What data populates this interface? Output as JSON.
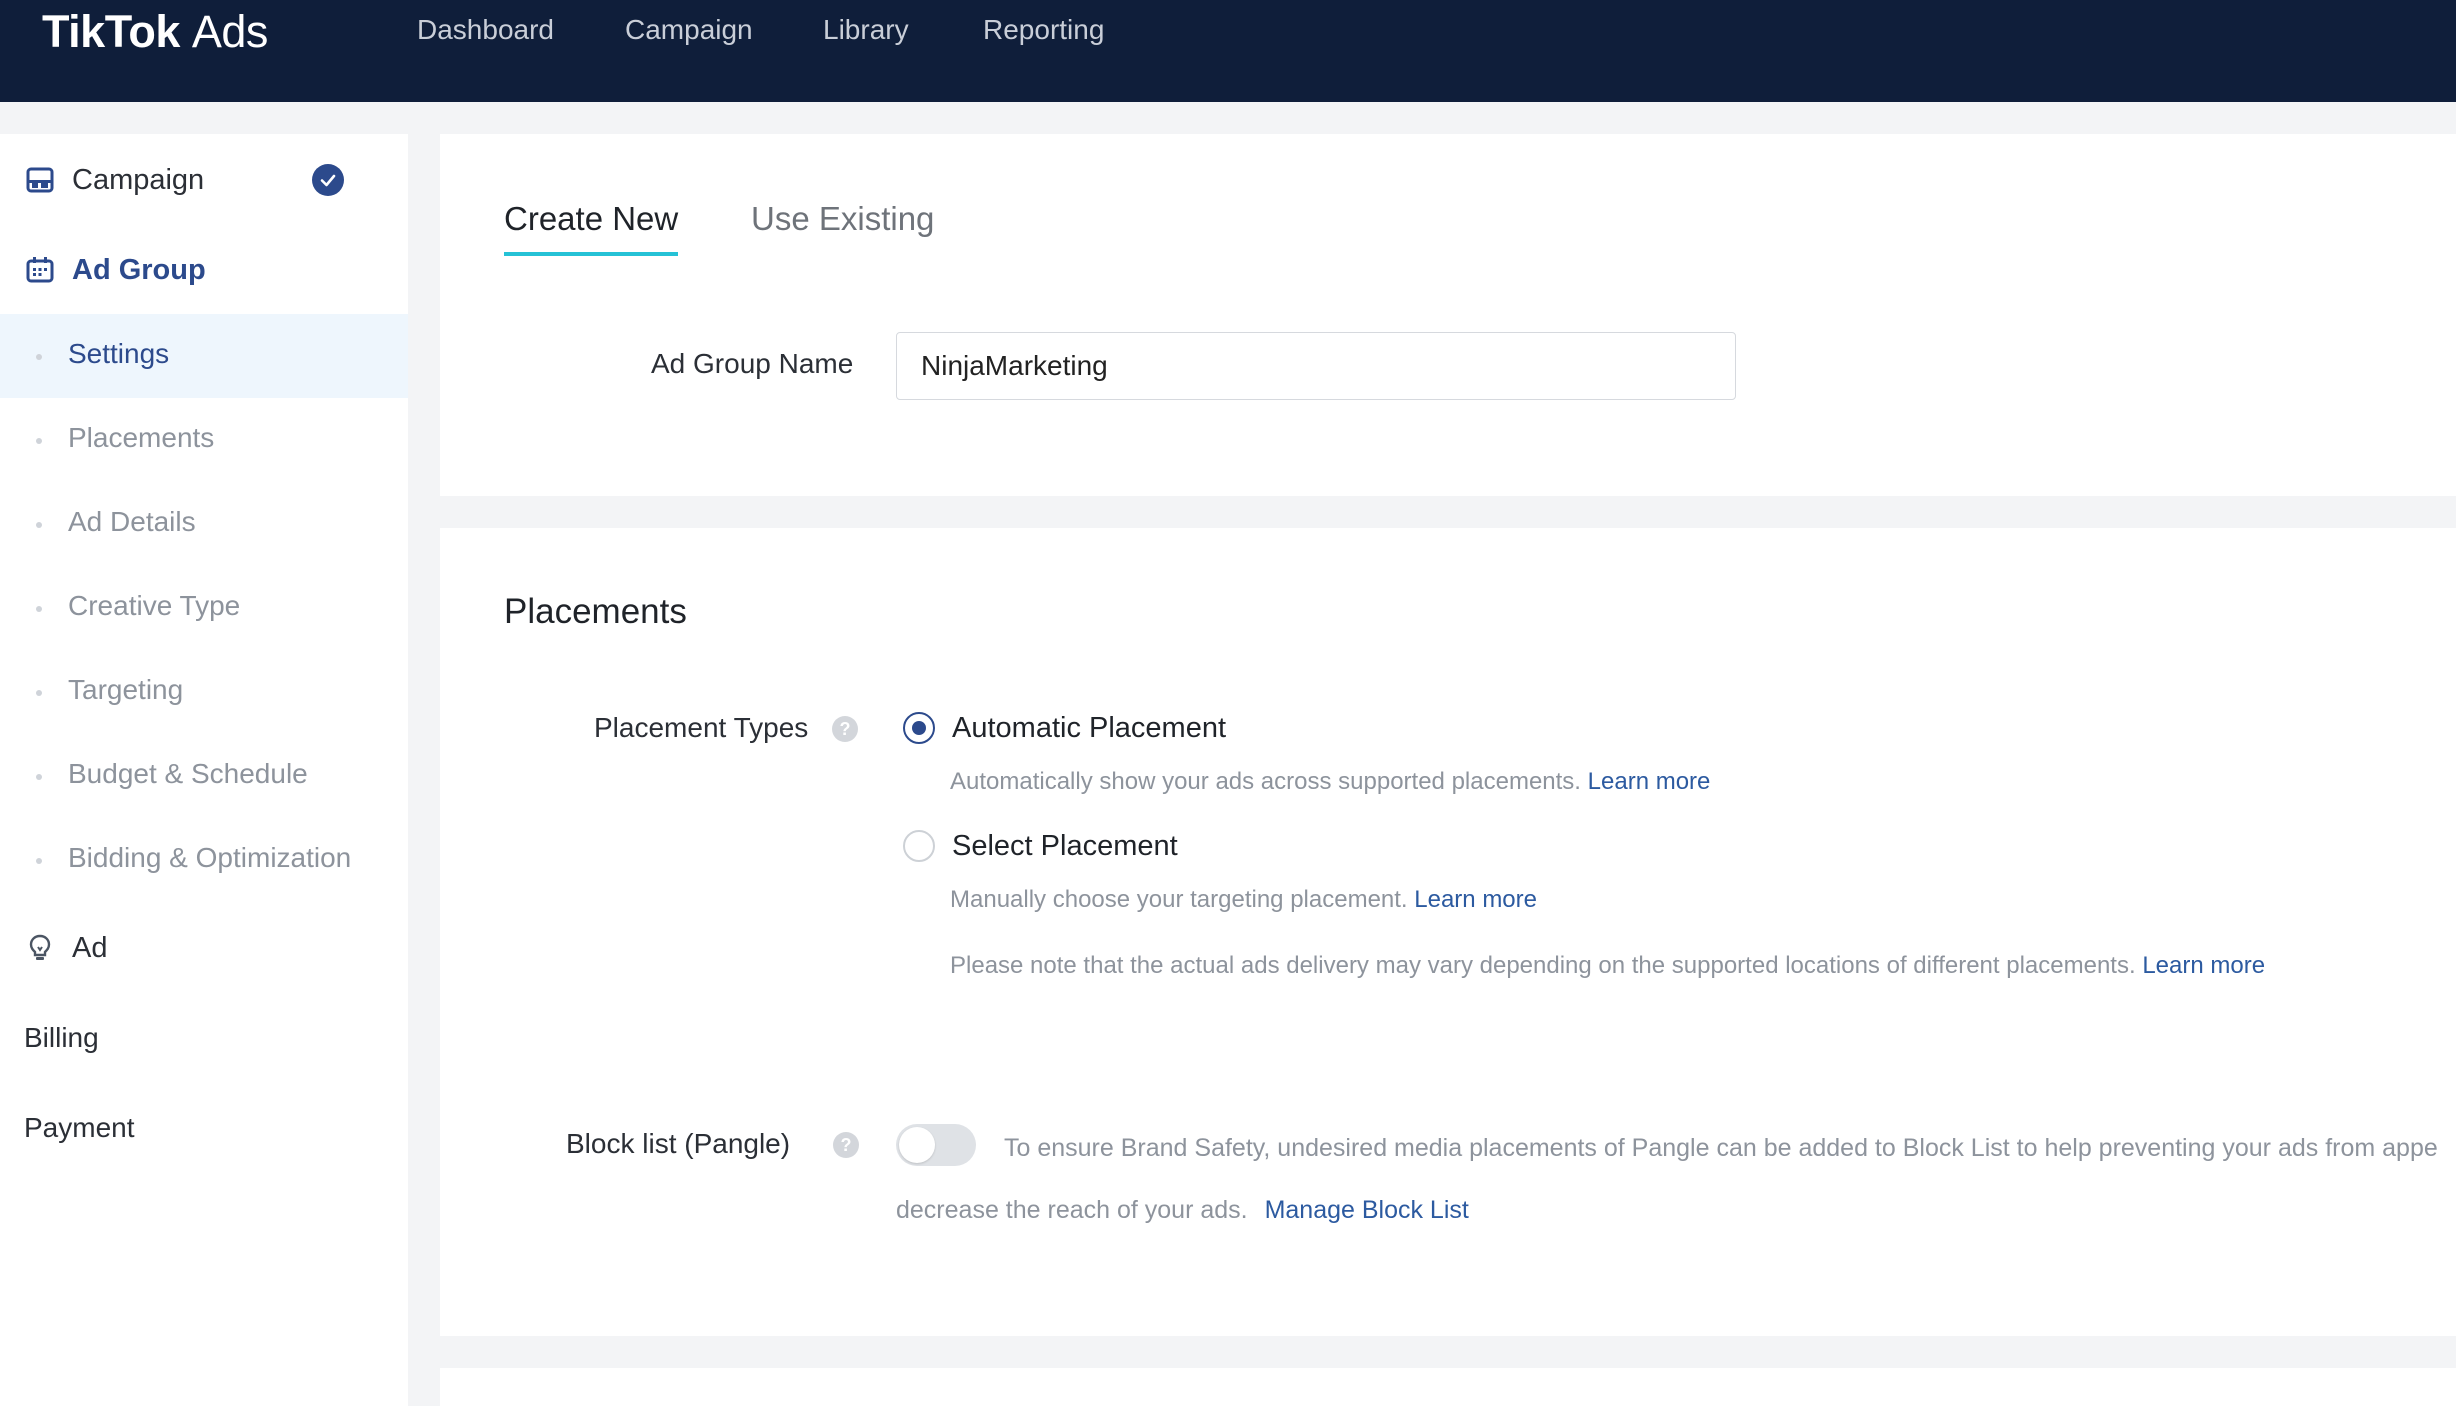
{
  "brand": {
    "name": "TikTok",
    "suffix": "Ads"
  },
  "nav": {
    "items": [
      "Dashboard",
      "Campaign",
      "Library",
      "Reporting"
    ]
  },
  "sidebar": {
    "campaign": {
      "label": "Campaign",
      "completed": true
    },
    "ad_group": {
      "label": "Ad Group"
    },
    "sub_items": [
      "Settings",
      "Placements",
      "Ad Details",
      "Creative Type",
      "Targeting",
      "Budget & Schedule",
      "Bidding & Optimization"
    ],
    "selected_sub_item": "Settings",
    "ad": {
      "label": "Ad"
    },
    "billing": {
      "label": "Billing"
    },
    "payment": {
      "label": "Payment"
    }
  },
  "ad_group_card": {
    "tabs": [
      "Create New",
      "Use Existing"
    ],
    "active_tab": "Create New",
    "name_label": "Ad Group Name",
    "name_value": "NinjaMarketing"
  },
  "placements": {
    "title": "Placements",
    "types_label": "Placement Types",
    "options": [
      {
        "label": "Automatic Placement",
        "checked": true,
        "hint": "Automatically show your ads across supported placements.",
        "link": "Learn more"
      },
      {
        "label": "Select Placement",
        "checked": false,
        "hint": "Manually choose your targeting placement.",
        "link": "Learn more"
      }
    ],
    "note": "Please note that the actual ads delivery may vary depending on the supported locations of different placements.",
    "note_link": "Learn more",
    "block_list": {
      "label": "Block list (Pangle)",
      "enabled": false,
      "description_line1": "To ensure Brand Safety, undesired media placements of Pangle can be added to Block List to help preventing your ads from appe",
      "description_line2": "decrease the reach of your ads.",
      "link": "Manage Block List"
    }
  },
  "colors": {
    "topbar": "#0f1e3a",
    "accent": "#2c4a8c",
    "tab_underline": "#25c2d6",
    "link": "#2c5aa0",
    "selected_bg": "#eef6fd"
  }
}
